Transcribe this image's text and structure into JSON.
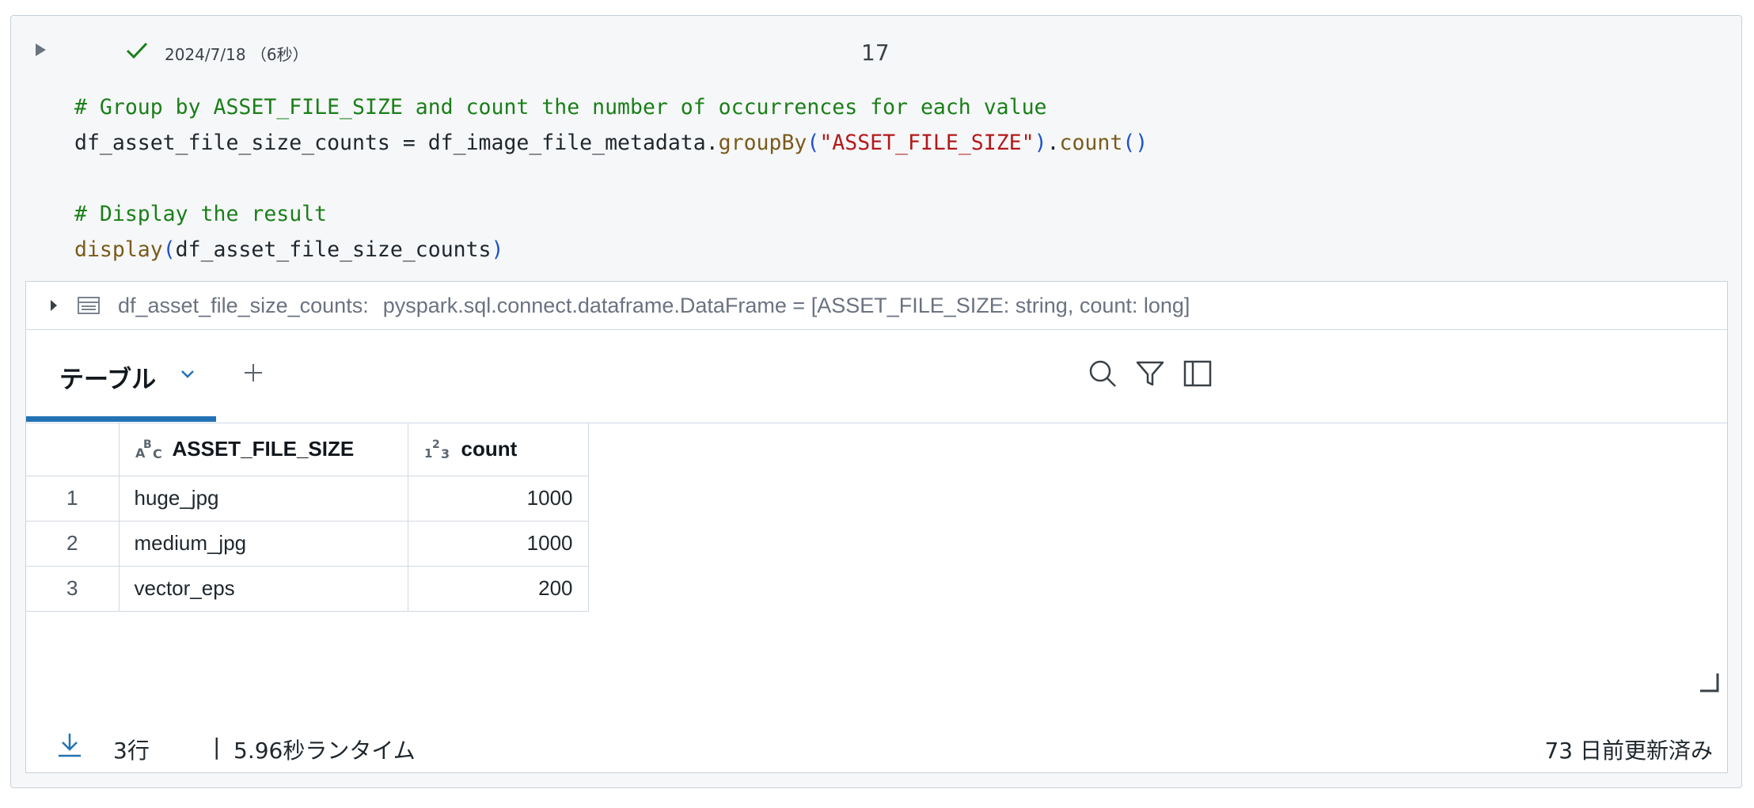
{
  "cell": {
    "run_time": "2024/7/18 （6秒）",
    "cell_number": "17"
  },
  "code": {
    "line1": "# Group by ASSET_FILE_SIZE and count the number of occurrences for each value",
    "line2_var": "df_asset_file_size_counts = df_image_file_metadata.",
    "line2_fn": "groupBy",
    "line2_arg": "\"ASSET_FILE_SIZE\"",
    "line2_fn2": "count",
    "line4": "# Display the result",
    "line5_fn": "display",
    "line5_arg": "df_asset_file_size_counts"
  },
  "output": {
    "schema_name": "df_asset_file_size_counts:",
    "schema_type": "pyspark.sql.connect.dataframe.DataFrame = [ASSET_FILE_SIZE: string, count: long]",
    "tab_label": "テーブル",
    "columns": [
      {
        "name": "ASSET_FILE_SIZE",
        "type_icon": "string-type-icon"
      },
      {
        "name": "count",
        "type_icon": "number-type-icon"
      }
    ],
    "rows": [
      {
        "idx": "1",
        "name": "huge_jpg",
        "count": "1000"
      },
      {
        "idx": "2",
        "name": "medium_jpg",
        "count": "1000"
      },
      {
        "idx": "3",
        "name": "vector_eps",
        "count": "200"
      }
    ],
    "footer": {
      "rows": "3行",
      "separator": "|",
      "runtime": "5.96秒ランタイム",
      "updated": "73 日前更新済み"
    }
  },
  "colors": {
    "accent": "#2272b4",
    "success": "#1a7f18",
    "comment": "#1a7f18",
    "string": "#b4191a",
    "function": "#7a5b1a",
    "paren": "#1f52c9"
  }
}
